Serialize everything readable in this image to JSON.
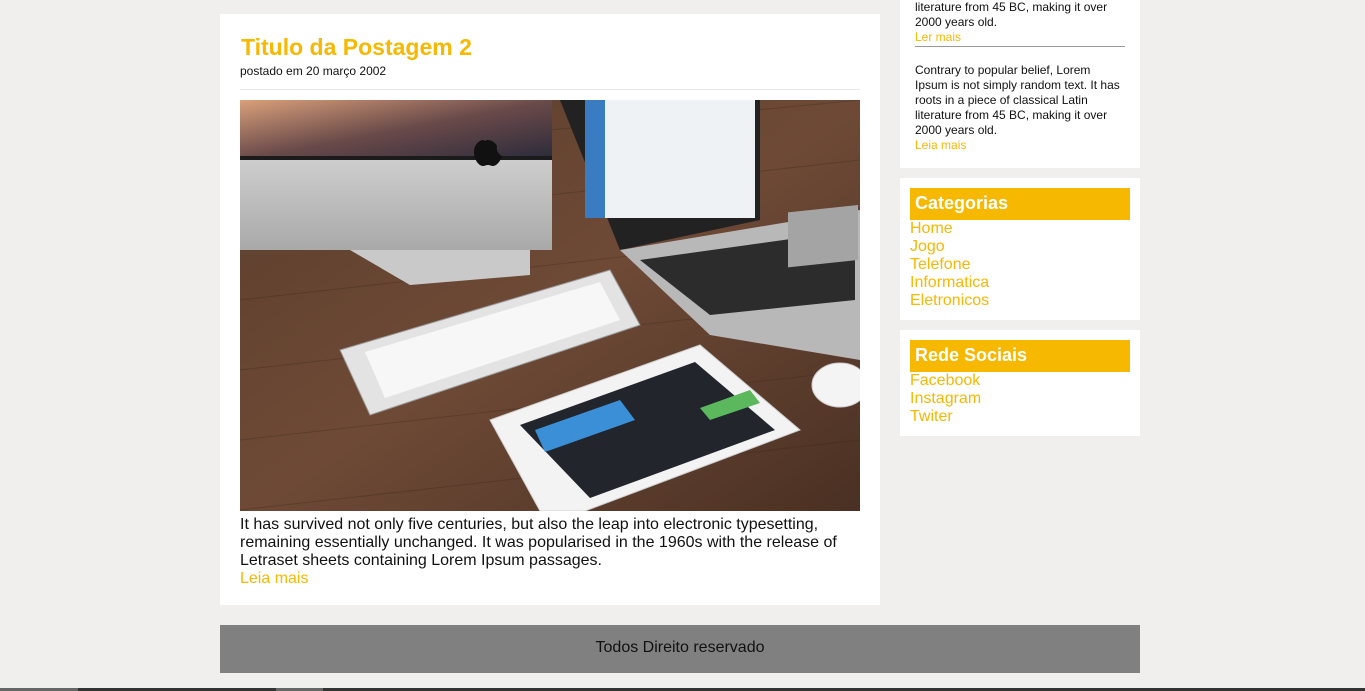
{
  "post": {
    "title": "Titulo da Postagem 2",
    "date": "postado em 20 março 2002",
    "image_description": "desk setup",
    "excerpt": "It has survived not only five centuries, but also the leap into electronic typesetting, remaining essentially unchanged. It was popularised in the 1960s with the release of Letraset sheets containing Lorem Ipsum passages.",
    "read_more": "Leia mais"
  },
  "recent": {
    "item1_text": "literature from 45 BC, making it over 2000 years old.",
    "item1_link": "Ler mais",
    "item2_text": "Contrary to popular belief, Lorem Ipsum is not simply random text. It has roots in a piece of classical Latin literature from 45 BC, making it over 2000 years old.",
    "item2_link": "Leia mais"
  },
  "categories": {
    "title": "Categorias",
    "items": [
      "Home",
      "Jogo",
      "Telefone",
      "Informatica",
      "Eletronicos"
    ]
  },
  "socials": {
    "title": "Rede Sociais",
    "items": [
      "Facebook",
      "Instagram",
      "Twiter"
    ]
  },
  "footer": {
    "text": "Todos Direito reservado"
  },
  "colors": {
    "accent": "#f6b800",
    "background": "#f0efed",
    "footer": "#808080"
  }
}
